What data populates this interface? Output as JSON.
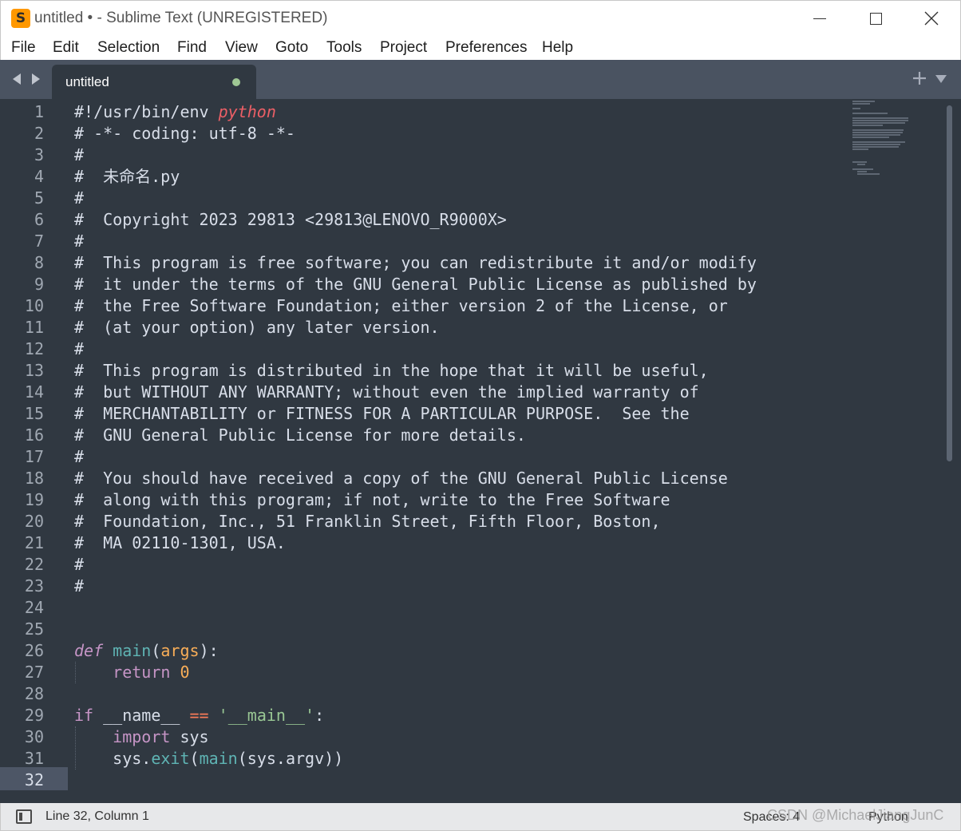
{
  "window": {
    "title": "untitled • - Sublime Text (UNREGISTERED)",
    "logo_letter": "S"
  },
  "menu": [
    "File",
    "Edit",
    "Selection",
    "Find",
    "View",
    "Goto",
    "Tools",
    "Project",
    "Preferences",
    "Help"
  ],
  "tab": {
    "label": "untitled",
    "dirty": true
  },
  "gutter": {
    "line_numbers": [
      "1",
      "2",
      "3",
      "4",
      "5",
      "6",
      "7",
      "8",
      "9",
      "10",
      "11",
      "12",
      "13",
      "14",
      "15",
      "16",
      "17",
      "18",
      "19",
      "20",
      "21",
      "22",
      "23",
      "24",
      "25",
      "26",
      "27",
      "28",
      "29",
      "30",
      "31",
      "32"
    ],
    "current_line": "32"
  },
  "code": {
    "l1_a": "#!/usr/bin/env ",
    "l1_b": "python",
    "l2": "# -*- coding: utf-8 -*-",
    "l3": "#",
    "l4": "#  未命名.py",
    "l5": "#",
    "l6": "#  Copyright 2023 29813 <29813@LENOVO_R9000X>",
    "l7": "#",
    "l8": "#  This program is free software; you can redistribute it and/or modify",
    "l9": "#  it under the terms of the GNU General Public License as published by",
    "l10": "#  the Free Software Foundation; either version 2 of the License, or",
    "l11": "#  (at your option) any later version.",
    "l12": "#",
    "l13": "#  This program is distributed in the hope that it will be useful,",
    "l14": "#  but WITHOUT ANY WARRANTY; without even the implied warranty of",
    "l15": "#  MERCHANTABILITY or FITNESS FOR A PARTICULAR PURPOSE.  See the",
    "l16": "#  GNU General Public License for more details.",
    "l17": "#",
    "l18": "#  You should have received a copy of the GNU General Public License",
    "l19": "#  along with this program; if not, write to the Free Software",
    "l20": "#  Foundation, Inc., 51 Franklin Street, Fifth Floor, Boston,",
    "l21": "#  MA 02110-1301, USA.",
    "l22": "#",
    "l23": "#",
    "l26_def": "def",
    "l26_sp": " ",
    "l26_fn": "main",
    "l26_p1": "(",
    "l26_arg": "args",
    "l26_p2": "):",
    "l27_indent": "    ",
    "l27_kw": "return",
    "l27_sp": " ",
    "l27_num": "0",
    "l29_kw": "if",
    "l29_name": " __name__ ",
    "l29_op": "==",
    "l29_sp": " ",
    "l29_str": "'__main__'",
    "l29_colon": ":",
    "l30_indent": "    ",
    "l30_kw": "import",
    "l30_mod": " sys",
    "l31_indent": "    ",
    "l31_obj": "sys.",
    "l31_fn": "exit",
    "l31_p1": "(",
    "l31_call": "main",
    "l31_rest": "(sys.argv))"
  },
  "status": {
    "position": "Line 32, Column 1",
    "spaces": "Spaces: 4",
    "syntax": "Python",
    "watermark": "CSDN @MichaelJiangJunC"
  },
  "colors": {
    "editor_bg": "#303841",
    "tabbar_bg": "#4a5361",
    "comment": "#d8dee9",
    "keyword": "#c695c6",
    "function": "#5fb4b4",
    "parameter": "#f9ae58",
    "string": "#99c794",
    "operator": "#f97b58",
    "accent_red": "#ec5f66"
  }
}
